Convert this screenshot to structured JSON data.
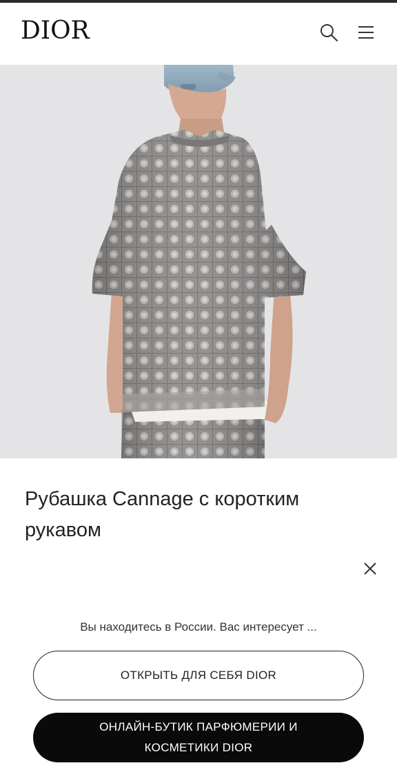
{
  "header": {
    "logo": "DIOR",
    "icons": [
      "search-icon",
      "menu-icon"
    ]
  },
  "carousel": {
    "total": 5,
    "active_index": 2
  },
  "product": {
    "title": "Рубашка Cannage с коротким рукавом"
  },
  "location_prompt": {
    "question": "Вы находитесь в России. Вас интересует ...",
    "option_primary": "ОТКРЫТЬ ДЛЯ СЕБЯ DIOR",
    "option_secondary": "ОНЛАЙН-БУТИК ПАРФЮМЕРИИ И КОСМЕТИКИ DIOR"
  },
  "colors": {
    "background": "#ffffff",
    "hero_background": "#e4e4e6",
    "button_dark": "#0a0a0a",
    "text": "#222222"
  }
}
